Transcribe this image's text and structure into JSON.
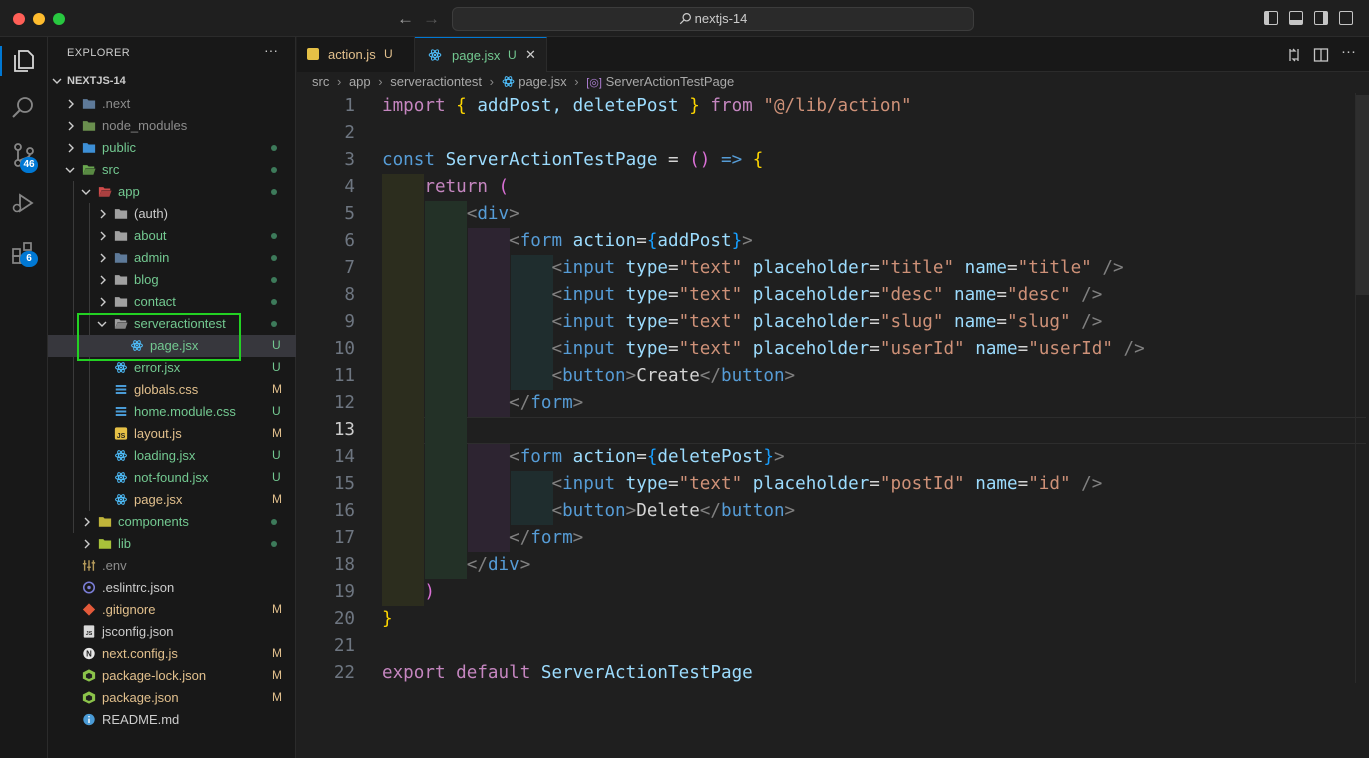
{
  "window": {
    "search": "nextjs-14"
  },
  "activity": {
    "source_control_badge": "46",
    "extensions_badge": "6"
  },
  "sidebar": {
    "title": "EXPLORER",
    "more": "···",
    "root": "NEXTJS-14",
    "tree": [
      {
        "label": ".next",
        "status": "",
        "dot": false
      },
      {
        "label": "node_modules",
        "status": "",
        "dot": false
      },
      {
        "label": "public",
        "status": "",
        "dot": true
      },
      {
        "label": "src",
        "status": "",
        "dot": true
      },
      {
        "label": "app",
        "status": "",
        "dot": true
      },
      {
        "label": "(auth)",
        "status": "",
        "dot": false
      },
      {
        "label": "about",
        "status": "",
        "dot": true
      },
      {
        "label": "admin",
        "status": "",
        "dot": true
      },
      {
        "label": "blog",
        "status": "",
        "dot": true
      },
      {
        "label": "contact",
        "status": "",
        "dot": true
      },
      {
        "label": "serveractiontest",
        "status": "",
        "dot": true
      },
      {
        "label": "page.jsx",
        "status": "U",
        "dot": false
      },
      {
        "label": "error.jsx",
        "status": "U",
        "dot": false
      },
      {
        "label": "globals.css",
        "status": "M",
        "dot": false
      },
      {
        "label": "home.module.css",
        "status": "U",
        "dot": false
      },
      {
        "label": "layout.js",
        "status": "M",
        "dot": false
      },
      {
        "label": "loading.jsx",
        "status": "U",
        "dot": false
      },
      {
        "label": "not-found.jsx",
        "status": "U",
        "dot": false
      },
      {
        "label": "page.jsx",
        "status": "M",
        "dot": false
      },
      {
        "label": "components",
        "status": "",
        "dot": true
      },
      {
        "label": "lib",
        "status": "",
        "dot": true
      },
      {
        "label": ".env",
        "status": "",
        "dot": false
      },
      {
        "label": ".eslintrc.json",
        "status": "",
        "dot": false
      },
      {
        "label": ".gitignore",
        "status": "M",
        "dot": false
      },
      {
        "label": "jsconfig.json",
        "status": "",
        "dot": false
      },
      {
        "label": "next.config.js",
        "status": "M",
        "dot": false
      },
      {
        "label": "package-lock.json",
        "status": "M",
        "dot": false
      },
      {
        "label": "package.json",
        "status": "M",
        "dot": false
      },
      {
        "label": "README.md",
        "status": "",
        "dot": false
      }
    ]
  },
  "tabs": [
    {
      "label": "action.js",
      "status": "U"
    },
    {
      "label": "page.jsx",
      "status": "U",
      "close": "✕"
    }
  ],
  "breadcrumb": [
    "src",
    "app",
    "serveractiontest",
    "page.jsx",
    "ServerActionTestPage"
  ],
  "editor": {
    "line_numbers": [
      "1",
      "2",
      "3",
      "4",
      "5",
      "6",
      "7",
      "8",
      "9",
      "10",
      "11",
      "12",
      "13",
      "14",
      "15",
      "16",
      "17",
      "18",
      "19",
      "20",
      "21",
      "22"
    ],
    "active_line": "13",
    "lines": [
      [
        [
          "import",
          "kw"
        ],
        [
          " ",
          "txt"
        ],
        [
          "{",
          "br1"
        ],
        [
          " addPost, deletePost ",
          "id"
        ],
        [
          "}",
          "br1"
        ],
        [
          " ",
          "txt"
        ],
        [
          "from",
          "kw"
        ],
        [
          " ",
          "txt"
        ],
        [
          "\"@/lib/action\"",
          "str"
        ]
      ],
      [],
      [
        [
          "const",
          "kwb"
        ],
        [
          " ",
          "txt"
        ],
        [
          "ServerActionTestPage",
          "id"
        ],
        [
          " = ",
          "txt"
        ],
        [
          "()",
          "br2"
        ],
        [
          " ",
          "txt"
        ],
        [
          "=>",
          "kwb"
        ],
        [
          " ",
          "txt"
        ],
        [
          "{",
          "br1"
        ]
      ],
      [
        [
          "    ",
          "txt"
        ],
        [
          "return",
          "kw"
        ],
        [
          " ",
          "txt"
        ],
        [
          "(",
          "br2"
        ]
      ],
      [
        [
          "        ",
          "txt"
        ],
        [
          "<",
          "pun"
        ],
        [
          "div",
          "tag"
        ],
        [
          ">",
          "pun"
        ]
      ],
      [
        [
          "            ",
          "txt"
        ],
        [
          "<",
          "pun"
        ],
        [
          "form",
          "tag"
        ],
        [
          " ",
          "txt"
        ],
        [
          "action",
          "id"
        ],
        [
          "=",
          "txt"
        ],
        [
          "{",
          "br3"
        ],
        [
          "addPost",
          "id"
        ],
        [
          "}",
          "br3"
        ],
        [
          ">",
          "pun"
        ]
      ],
      [
        [
          "                ",
          "txt"
        ],
        [
          "<",
          "pun"
        ],
        [
          "input",
          "tag"
        ],
        [
          " ",
          "txt"
        ],
        [
          "type",
          "id"
        ],
        [
          "=",
          "txt"
        ],
        [
          "\"text\"",
          "str"
        ],
        [
          " ",
          "txt"
        ],
        [
          "placeholder",
          "id"
        ],
        [
          "=",
          "txt"
        ],
        [
          "\"title\"",
          "str"
        ],
        [
          " ",
          "txt"
        ],
        [
          "name",
          "id"
        ],
        [
          "=",
          "txt"
        ],
        [
          "\"title\"",
          "str"
        ],
        [
          " />",
          "pun"
        ]
      ],
      [
        [
          "                ",
          "txt"
        ],
        [
          "<",
          "pun"
        ],
        [
          "input",
          "tag"
        ],
        [
          " ",
          "txt"
        ],
        [
          "type",
          "id"
        ],
        [
          "=",
          "txt"
        ],
        [
          "\"text\"",
          "str"
        ],
        [
          " ",
          "txt"
        ],
        [
          "placeholder",
          "id"
        ],
        [
          "=",
          "txt"
        ],
        [
          "\"desc\"",
          "str"
        ],
        [
          " ",
          "txt"
        ],
        [
          "name",
          "id"
        ],
        [
          "=",
          "txt"
        ],
        [
          "\"desc\"",
          "str"
        ],
        [
          " />",
          "pun"
        ]
      ],
      [
        [
          "                ",
          "txt"
        ],
        [
          "<",
          "pun"
        ],
        [
          "input",
          "tag"
        ],
        [
          " ",
          "txt"
        ],
        [
          "type",
          "id"
        ],
        [
          "=",
          "txt"
        ],
        [
          "\"text\"",
          "str"
        ],
        [
          " ",
          "txt"
        ],
        [
          "placeholder",
          "id"
        ],
        [
          "=",
          "txt"
        ],
        [
          "\"slug\"",
          "str"
        ],
        [
          " ",
          "txt"
        ],
        [
          "name",
          "id"
        ],
        [
          "=",
          "txt"
        ],
        [
          "\"slug\"",
          "str"
        ],
        [
          " />",
          "pun"
        ]
      ],
      [
        [
          "                ",
          "txt"
        ],
        [
          "<",
          "pun"
        ],
        [
          "input",
          "tag"
        ],
        [
          " ",
          "txt"
        ],
        [
          "type",
          "id"
        ],
        [
          "=",
          "txt"
        ],
        [
          "\"text\"",
          "str"
        ],
        [
          " ",
          "txt"
        ],
        [
          "placeholder",
          "id"
        ],
        [
          "=",
          "txt"
        ],
        [
          "\"userId\"",
          "str"
        ],
        [
          " ",
          "txt"
        ],
        [
          "name",
          "id"
        ],
        [
          "=",
          "txt"
        ],
        [
          "\"userId\"",
          "str"
        ],
        [
          " />",
          "pun"
        ]
      ],
      [
        [
          "                ",
          "txt"
        ],
        [
          "<",
          "pun"
        ],
        [
          "button",
          "tag"
        ],
        [
          ">",
          "pun"
        ],
        [
          "Create",
          "txt"
        ],
        [
          "</",
          "pun"
        ],
        [
          "button",
          "tag"
        ],
        [
          ">",
          "pun"
        ]
      ],
      [
        [
          "            ",
          "txt"
        ],
        [
          "</",
          "pun"
        ],
        [
          "form",
          "tag"
        ],
        [
          ">",
          "pun"
        ]
      ],
      [],
      [
        [
          "            ",
          "txt"
        ],
        [
          "<",
          "pun"
        ],
        [
          "form",
          "tag"
        ],
        [
          " ",
          "txt"
        ],
        [
          "action",
          "id"
        ],
        [
          "=",
          "txt"
        ],
        [
          "{",
          "br3"
        ],
        [
          "deletePost",
          "id"
        ],
        [
          "}",
          "br3"
        ],
        [
          ">",
          "pun"
        ]
      ],
      [
        [
          "                ",
          "txt"
        ],
        [
          "<",
          "pun"
        ],
        [
          "input",
          "tag"
        ],
        [
          " ",
          "txt"
        ],
        [
          "type",
          "id"
        ],
        [
          "=",
          "txt"
        ],
        [
          "\"text\"",
          "str"
        ],
        [
          " ",
          "txt"
        ],
        [
          "placeholder",
          "id"
        ],
        [
          "=",
          "txt"
        ],
        [
          "\"postId\"",
          "str"
        ],
        [
          " ",
          "txt"
        ],
        [
          "name",
          "id"
        ],
        [
          "=",
          "txt"
        ],
        [
          "\"id\"",
          "str"
        ],
        [
          " />",
          "pun"
        ]
      ],
      [
        [
          "                ",
          "txt"
        ],
        [
          "<",
          "pun"
        ],
        [
          "button",
          "tag"
        ],
        [
          ">",
          "pun"
        ],
        [
          "Delete",
          "txt"
        ],
        [
          "</",
          "pun"
        ],
        [
          "button",
          "tag"
        ],
        [
          ">",
          "pun"
        ]
      ],
      [
        [
          "            ",
          "txt"
        ],
        [
          "</",
          "pun"
        ],
        [
          "form",
          "tag"
        ],
        [
          ">",
          "pun"
        ]
      ],
      [
        [
          "        ",
          "txt"
        ],
        [
          "</",
          "pun"
        ],
        [
          "div",
          "tag"
        ],
        [
          ">",
          "pun"
        ]
      ],
      [
        [
          "    ",
          "txt"
        ],
        [
          ")",
          "br2"
        ]
      ],
      [
        [
          "}",
          "br1"
        ]
      ],
      [],
      [
        [
          "export",
          "kw"
        ],
        [
          " ",
          "txt"
        ],
        [
          "default",
          "kw"
        ],
        [
          " ",
          "txt"
        ],
        [
          "ServerActionTestPage",
          "id"
        ]
      ]
    ]
  },
  "colors": {
    "accent": "#0078d4",
    "highlight_box": "#23d123",
    "untracked": "#73c991",
    "modified": "#e2c08d"
  }
}
